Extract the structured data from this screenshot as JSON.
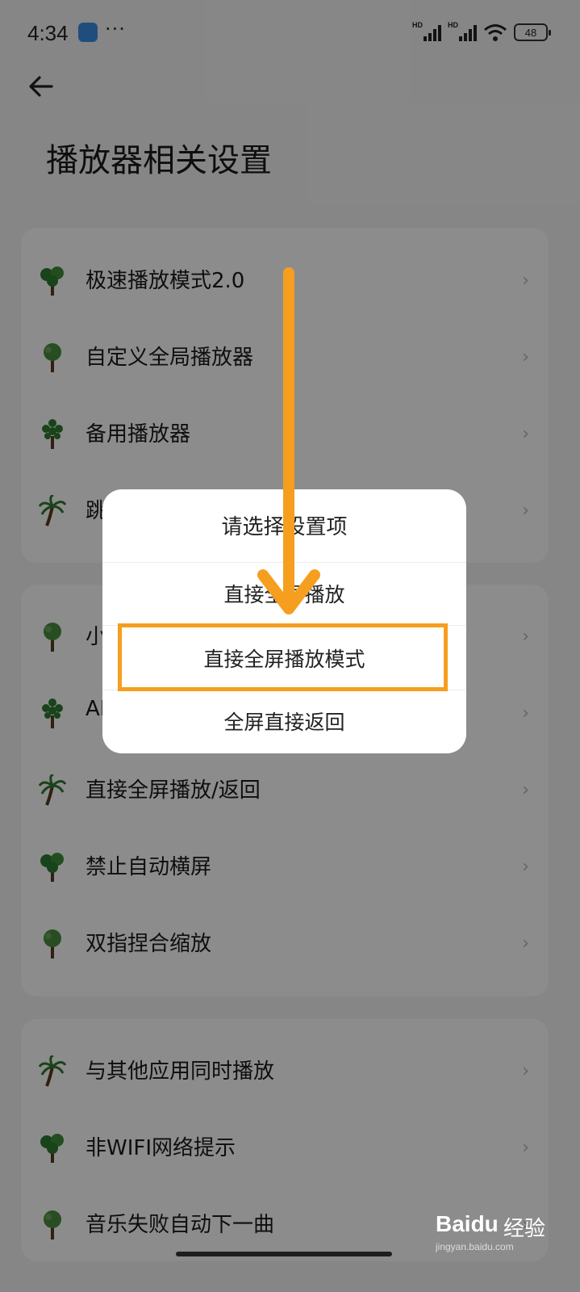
{
  "status_bar": {
    "time": "4:34",
    "more": "···",
    "network_1": "HD",
    "network_2": "HD",
    "battery": "48"
  },
  "page": {
    "title": "播放器相关设置"
  },
  "card_1": {
    "items": [
      {
        "label": "极速播放模式2.0",
        "icon": "tree-icon"
      },
      {
        "label": "自定义全局播放器",
        "icon": "tree-icon"
      },
      {
        "label": "备用播放器",
        "icon": "tree-icon"
      },
      {
        "label": "跳",
        "icon": "palm-icon"
      }
    ]
  },
  "card_2": {
    "items": [
      {
        "label": "小",
        "icon": "tree-icon"
      },
      {
        "label": "AI",
        "icon": "tree-icon"
      },
      {
        "label": "直接全屏播放/返回",
        "icon": "palm-icon"
      },
      {
        "label": "禁止自动横屏",
        "icon": "tree-icon"
      },
      {
        "label": "双指捏合缩放",
        "icon": "tree-icon"
      }
    ]
  },
  "card_3": {
    "items": [
      {
        "label": "与其他应用同时播放",
        "icon": "palm-icon"
      },
      {
        "label": "非WIFI网络提示",
        "icon": "tree-icon"
      },
      {
        "label": "音乐失败自动下一曲",
        "icon": "tree-icon"
      }
    ]
  },
  "dialog": {
    "title": "请选择设置项",
    "options": [
      "直接全屏播放",
      "直接全屏播放模式",
      "全屏直接返回"
    ]
  },
  "colors": {
    "accent_orange": "#f59e1f",
    "tree_green": "#2f7a32"
  },
  "watermark": {
    "brand": "Baidu",
    "brand_cn": "经验",
    "url": "jingyan.baidu.com"
  }
}
